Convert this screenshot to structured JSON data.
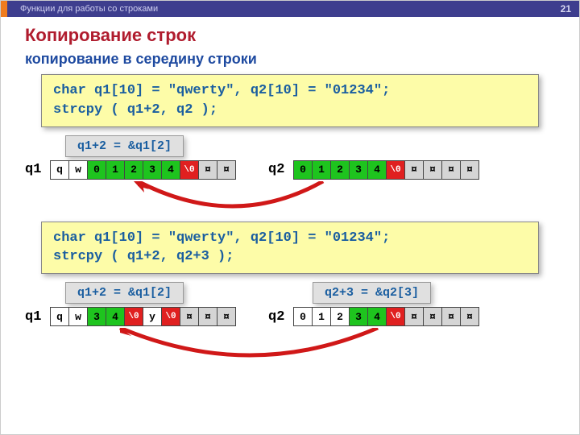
{
  "header": {
    "title": "Функции для работы со строками",
    "page": "21"
  },
  "h1": "Копирование строк",
  "h2": "копирование в середину строки",
  "code1": {
    "line1": "char q1[10] = \"qwerty\", q2[10] = \"01234\";",
    "line2": "strcpy ( q1+2, q2 );"
  },
  "code2": {
    "line1": "char q1[10] = \"qwerty\", q2[10] = \"01234\";",
    "line2": "strcpy ( q1+2, q2+3 );"
  },
  "annot": {
    "a1": "q1+2 = &q1[2]",
    "a2": "q2+3 = &q2[3]"
  },
  "labels": {
    "q1": "q1",
    "q2": "q2"
  },
  "ex1": {
    "q1": [
      {
        "t": "q",
        "c": ""
      },
      {
        "t": "w",
        "c": ""
      },
      {
        "t": "0",
        "c": "green"
      },
      {
        "t": "1",
        "c": "green"
      },
      {
        "t": "2",
        "c": "green"
      },
      {
        "t": "3",
        "c": "green"
      },
      {
        "t": "4",
        "c": "green"
      },
      {
        "t": "\\0",
        "c": "red"
      },
      {
        "t": "¤",
        "c": "grey"
      },
      {
        "t": "¤",
        "c": "grey"
      }
    ],
    "q2": [
      {
        "t": "0",
        "c": "green"
      },
      {
        "t": "1",
        "c": "green"
      },
      {
        "t": "2",
        "c": "green"
      },
      {
        "t": "3",
        "c": "green"
      },
      {
        "t": "4",
        "c": "green"
      },
      {
        "t": "\\0",
        "c": "red"
      },
      {
        "t": "¤",
        "c": "grey"
      },
      {
        "t": "¤",
        "c": "grey"
      },
      {
        "t": "¤",
        "c": "grey"
      },
      {
        "t": "¤",
        "c": "grey"
      }
    ]
  },
  "ex2": {
    "q1": [
      {
        "t": "q",
        "c": ""
      },
      {
        "t": "w",
        "c": ""
      },
      {
        "t": "3",
        "c": "green"
      },
      {
        "t": "4",
        "c": "green"
      },
      {
        "t": "\\0",
        "c": "red"
      },
      {
        "t": "y",
        "c": ""
      },
      {
        "t": "\\0",
        "c": "red"
      },
      {
        "t": "¤",
        "c": "grey"
      },
      {
        "t": "¤",
        "c": "grey"
      },
      {
        "t": "¤",
        "c": "grey"
      }
    ],
    "q2": [
      {
        "t": "0",
        "c": ""
      },
      {
        "t": "1",
        "c": ""
      },
      {
        "t": "2",
        "c": ""
      },
      {
        "t": "3",
        "c": "green"
      },
      {
        "t": "4",
        "c": "green"
      },
      {
        "t": "\\0",
        "c": "red"
      },
      {
        "t": "¤",
        "c": "grey"
      },
      {
        "t": "¤",
        "c": "grey"
      },
      {
        "t": "¤",
        "c": "grey"
      },
      {
        "t": "¤",
        "c": "grey"
      }
    ]
  }
}
